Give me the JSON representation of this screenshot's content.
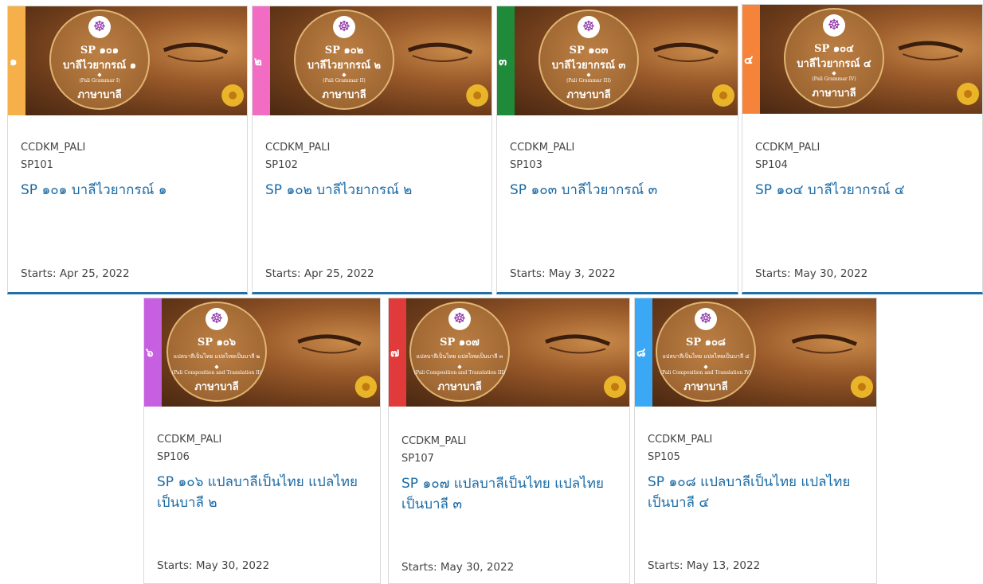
{
  "colors": {
    "link": "#1a6aa5",
    "bottom_bar": "#1f6fa8"
  },
  "medallion_lang": "ภาษาบาลี",
  "logo_icon": "dharma-wheel-icon",
  "cards": [
    {
      "strip_color": "#f5b04a",
      "strip_num": "๑",
      "med_code": "SP ๑๐๑",
      "med_title": "บาลีไวยากรณ์ ๑",
      "med_sub": "(Pali Grammar I)",
      "org": "CCDKM_PALI",
      "code": "SP101",
      "title": "SP ๑๐๑ บาลีไวยากรณ์ ๑",
      "starts": "Starts: Apr 25, 2022"
    },
    {
      "strip_color": "#f26cc4",
      "strip_num": "๒",
      "med_code": "SP ๑๐๒",
      "med_title": "บาลีไวยากรณ์ ๒",
      "med_sub": "(Pali Grammar II)",
      "org": "CCDKM_PALI",
      "code": "SP102",
      "title": "SP ๑๐๒ บาลีไวยากรณ์ ๒",
      "starts": "Starts: Apr 25, 2022"
    },
    {
      "strip_color": "#1e8a3a",
      "strip_num": "๓",
      "med_code": "SP ๑๐๓",
      "med_title": "บาลีไวยากรณ์ ๓",
      "med_sub": "(Pali Grammar III)",
      "org": "CCDKM_PALI",
      "code": "SP103",
      "title": "SP ๑๐๓ บาลีไวยากรณ์ ๓",
      "starts": "Starts: May 3, 2022"
    },
    {
      "strip_color": "#f5843a",
      "strip_num": "๔",
      "med_code": "SP ๑๐๔",
      "med_title": "บาลีไวยากรณ์ ๔",
      "med_sub": "(Pali Grammar IV)",
      "org": "CCDKM_PALI",
      "code": "SP104",
      "title": "SP ๑๐๔ บาลีไวยากรณ์ ๔",
      "starts": "Starts: May 30, 2022"
    },
    {
      "strip_color": "#c65fe0",
      "strip_num": "๖",
      "med_code": "SP ๑๐๖",
      "med_title": "แปลบาลีเป็นไทย แปลไทยเป็นบาลี ๒",
      "med_sub": "(Pali Composition and Translation II)",
      "org": "CCDKM_PALI",
      "code": "SP106",
      "title": "SP ๑๐๖ แปลบาลีเป็นไทย แปลไทยเป็นบาลี ๒",
      "starts": "Starts: May 30, 2022"
    },
    {
      "strip_color": "#e03a3a",
      "strip_num": "๗",
      "med_code": "SP ๑๐๗",
      "med_title": "แปลบาลีเป็นไทย แปลไทยเป็นบาลี ๓",
      "med_sub": "(Pali Composition and Translation III)",
      "org": "CCDKM_PALI",
      "code": "SP107",
      "title": "SP ๑๐๗ แปลบาลีเป็นไทย แปลไทยเป็นบาลี ๓",
      "starts": "Starts: May 30, 2022"
    },
    {
      "strip_color": "#3aa8f5",
      "strip_num": "๘",
      "med_code": "SP ๑๐๘",
      "med_title": "แปลบาลีเป็นไทย แปลไทยเป็นบาลี ๔",
      "med_sub": "(Pali Composition and Translation IV)",
      "org": "CCDKM_PALI",
      "code": "SP105",
      "title": "SP ๑๐๘ แปลบาลีเป็นไทย แปลไทยเป็นบาลี ๔",
      "starts": "Starts: May 13, 2022"
    }
  ]
}
